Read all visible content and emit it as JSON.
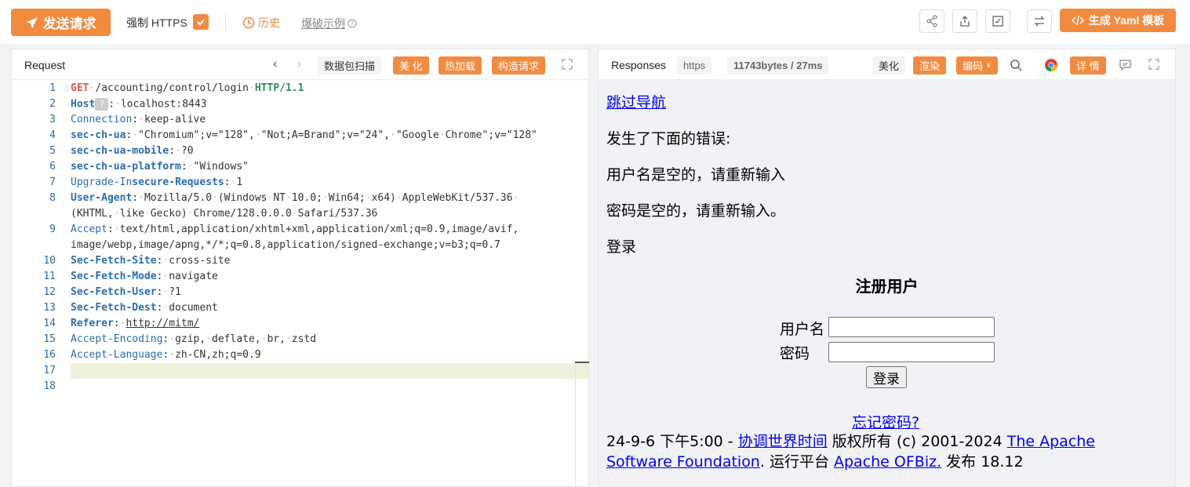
{
  "toolbar": {
    "send_label": "发送请求",
    "force_https_label": "强制 HTTPS",
    "force_https_checked": true,
    "history_label": "历史",
    "examples_label": "爆破示例",
    "yaml_label": "生成 Yaml 模板",
    "icons": [
      "share-icon",
      "export-icon",
      "edit-check-icon",
      "swap-icon"
    ]
  },
  "request": {
    "title": "Request",
    "tabs": [
      "数据包扫描",
      "美 化",
      "热加载",
      "构造请求"
    ],
    "lines": [
      {
        "n": "1",
        "segs": [
          [
            "m",
            "GET"
          ],
          [
            "d",
            "·"
          ],
          [
            "p",
            "/accounting/control/login"
          ],
          [
            "d",
            "·"
          ],
          [
            "v",
            "HTTP/1.1"
          ]
        ]
      },
      {
        "n": "2",
        "segs": [
          [
            "h",
            "Host"
          ],
          [
            "q",
            "?"
          ],
          [
            "p",
            ":"
          ],
          [
            "d",
            "·"
          ],
          [
            "p",
            "localhost:8443"
          ]
        ]
      },
      {
        "n": "3",
        "segs": [
          [
            "h2",
            "Connection"
          ],
          [
            "p",
            ":"
          ],
          [
            "d",
            "·"
          ],
          [
            "p",
            "keep-alive"
          ]
        ]
      },
      {
        "n": "4",
        "segs": [
          [
            "h",
            "sec-ch-ua"
          ],
          [
            "p",
            ":"
          ],
          [
            "d",
            "·"
          ],
          [
            "p",
            "\"Chromium\";v=\"128\","
          ],
          [
            "d",
            "·"
          ],
          [
            "p",
            "\"Not;A=Brand\";v=\"24\","
          ],
          [
            "d",
            "·"
          ],
          [
            "p",
            "\"Google"
          ],
          [
            "d",
            "·"
          ],
          [
            "p",
            "Chrome\";v=\"128\""
          ]
        ]
      },
      {
        "n": "5",
        "segs": [
          [
            "h",
            "sec-ch-ua-mobile"
          ],
          [
            "p",
            ":"
          ],
          [
            "d",
            "·"
          ],
          [
            "p",
            "?0"
          ]
        ]
      },
      {
        "n": "6",
        "segs": [
          [
            "h",
            "sec-ch-ua-platform"
          ],
          [
            "p",
            ":"
          ],
          [
            "d",
            "·"
          ],
          [
            "p",
            "\"Windows\""
          ]
        ]
      },
      {
        "n": "7",
        "segs": [
          [
            "h2",
            "Upgrade-In"
          ],
          [
            "h",
            "secure-Requests"
          ],
          [
            "p",
            ":"
          ],
          [
            "d",
            "·"
          ],
          [
            "p",
            "1"
          ]
        ]
      },
      {
        "n": "8",
        "segs": [
          [
            "h",
            "User-Agent"
          ],
          [
            "p",
            ":"
          ],
          [
            "d",
            "·"
          ],
          [
            "p",
            "Mozilla/5.0"
          ],
          [
            "d",
            "·"
          ],
          [
            "p",
            "(Windows"
          ],
          [
            "d",
            "·"
          ],
          [
            "p",
            "NT"
          ],
          [
            "d",
            "·"
          ],
          [
            "p",
            "10.0;"
          ],
          [
            "d",
            "·"
          ],
          [
            "p",
            "Win64;"
          ],
          [
            "d",
            "·"
          ],
          [
            "p",
            "x64)"
          ],
          [
            "d",
            "·"
          ],
          [
            "p",
            "AppleWebKit/537.36"
          ],
          [
            "d",
            "·"
          ]
        ]
      },
      {
        "n": "",
        "segs": [
          [
            "p",
            "(KHTML,"
          ],
          [
            "d",
            "·"
          ],
          [
            "p",
            "like"
          ],
          [
            "d",
            "·"
          ],
          [
            "p",
            "Gecko)"
          ],
          [
            "d",
            "·"
          ],
          [
            "p",
            "Chrome/128.0.0.0"
          ],
          [
            "d",
            "·"
          ],
          [
            "p",
            "Safari/537.36"
          ]
        ]
      },
      {
        "n": "9",
        "segs": [
          [
            "h2",
            "Accept"
          ],
          [
            "p",
            ":"
          ],
          [
            "d",
            "·"
          ],
          [
            "p",
            "text/html,application/xhtml+xml,application/xml;q=0.9,image/avif,"
          ]
        ]
      },
      {
        "n": "",
        "segs": [
          [
            "p",
            "image/webp,image/apng,*/*;q=0.8,application/signed-exchange;v=b3;q=0.7"
          ]
        ]
      },
      {
        "n": "10",
        "segs": [
          [
            "h",
            "Sec-Fetch-Site"
          ],
          [
            "p",
            ":"
          ],
          [
            "d",
            "·"
          ],
          [
            "p",
            "cross-site"
          ]
        ]
      },
      {
        "n": "11",
        "segs": [
          [
            "h",
            "Sec-Fetch-Mode"
          ],
          [
            "p",
            ":"
          ],
          [
            "d",
            "·"
          ],
          [
            "p",
            "navigate"
          ]
        ]
      },
      {
        "n": "12",
        "segs": [
          [
            "h",
            "Sec-Fetch-User"
          ],
          [
            "p",
            ":"
          ],
          [
            "d",
            "·"
          ],
          [
            "p",
            "?1"
          ]
        ]
      },
      {
        "n": "13",
        "segs": [
          [
            "h",
            "Sec-Fetch-Dest"
          ],
          [
            "p",
            ":"
          ],
          [
            "d",
            "·"
          ],
          [
            "p",
            "document"
          ]
        ]
      },
      {
        "n": "14",
        "segs": [
          [
            "h",
            "Referer"
          ],
          [
            "p",
            ":"
          ],
          [
            "d",
            "·"
          ],
          [
            "u",
            "http://mitm/"
          ]
        ]
      },
      {
        "n": "15",
        "segs": [
          [
            "h2",
            "Accept-Encoding"
          ],
          [
            "p",
            ":"
          ],
          [
            "d",
            "·"
          ],
          [
            "p",
            "gzip,"
          ],
          [
            "d",
            "·"
          ],
          [
            "p",
            "deflate,"
          ],
          [
            "d",
            "·"
          ],
          [
            "p",
            "br,"
          ],
          [
            "d",
            "·"
          ],
          [
            "p",
            "zstd"
          ]
        ]
      },
      {
        "n": "16",
        "segs": [
          [
            "h2",
            "Accept-Language"
          ],
          [
            "p",
            ":"
          ],
          [
            "d",
            "·"
          ],
          [
            "p",
            "zh-CN,zh;q=0.9"
          ]
        ]
      },
      {
        "n": "17",
        "segs": []
      },
      {
        "n": "18",
        "segs": []
      }
    ]
  },
  "response": {
    "title": "Responses",
    "protocol": "https",
    "size_time": "11743bytes / 27ms",
    "tabs": [
      "美化",
      "渲染",
      "编码",
      "详 情"
    ],
    "render": {
      "skip_nav": "跳过导航",
      "error_heading": "发生了下面的错误:",
      "error_user": "用户名是空的，请重新输入",
      "error_pass": "密码是空的，请重新输入。",
      "login_heading": "登录",
      "register_title": "注册用户",
      "username_label": "用户名",
      "password_label": "密码",
      "login_button": "登录",
      "forgot": "忘记密码?",
      "footer_date": "24-9-6 下午5:00 - ",
      "footer_tz": "协调世界时间",
      "footer_copy": " 版权所有 (c) 2001-2024 ",
      "footer_org1": "The Apache",
      "footer_org2": "Software Foundation",
      "footer_platform": ". 运行平台 ",
      "footer_ofbiz": "Apache OFBiz.",
      "footer_release": " 发布 18.12"
    }
  }
}
